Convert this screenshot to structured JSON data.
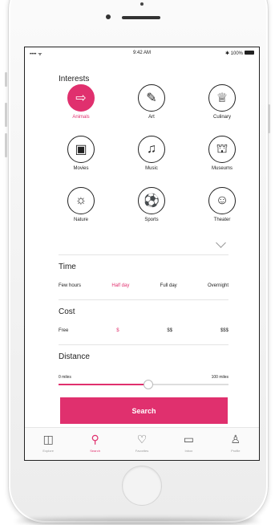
{
  "status_bar": {
    "carrier": "•••• ᯤ",
    "time": "9:42 AM",
    "battery": "✱ 100%"
  },
  "interests": {
    "title": "Interests",
    "items": [
      {
        "label": "Animals",
        "glyph": "⇨",
        "icon": "animal-paw-icon",
        "selected": true
      },
      {
        "label": "Art",
        "glyph": "✎",
        "icon": "palette-icon",
        "selected": false
      },
      {
        "label": "Culinary",
        "glyph": "♕",
        "icon": "chef-hat-icon",
        "selected": false
      },
      {
        "label": "Movies",
        "glyph": "▣",
        "icon": "film-icon",
        "selected": false
      },
      {
        "label": "Music",
        "glyph": "♫",
        "icon": "music-note-icon",
        "selected": false
      },
      {
        "label": "Museums",
        "glyph": "⛫",
        "icon": "museum-icon",
        "selected": false
      },
      {
        "label": "Nature",
        "glyph": "☼",
        "icon": "sun-icon",
        "selected": false
      },
      {
        "label": "Sports",
        "glyph": "⚽",
        "icon": "ball-icon",
        "selected": false
      },
      {
        "label": "Theater",
        "glyph": "☺",
        "icon": "theater-mask-icon",
        "selected": false
      }
    ]
  },
  "time": {
    "title": "Time",
    "options": [
      "Few hours",
      "Half day",
      "Full day",
      "Overnight"
    ],
    "selected": "Half day"
  },
  "cost": {
    "title": "Cost",
    "options": [
      "Free",
      "$",
      "$$",
      "$$$"
    ],
    "selected": "$"
  },
  "distance": {
    "title": "Distance",
    "min_label": "0 miles",
    "max_label": "100 miles",
    "value_fraction": 0.53
  },
  "search_button": {
    "label": "Search"
  },
  "tabs": [
    {
      "label": "Explore",
      "glyph": "◫",
      "icon": "map-icon",
      "active": false
    },
    {
      "label": "Search",
      "glyph": "⚲",
      "icon": "search-icon",
      "active": true
    },
    {
      "label": "Favorites",
      "glyph": "♡",
      "icon": "heart-icon",
      "active": false
    },
    {
      "label": "Inbox",
      "glyph": "▭",
      "icon": "chat-icon",
      "active": false
    },
    {
      "label": "Profile",
      "glyph": "♙",
      "icon": "profile-icon",
      "active": false
    }
  ],
  "colors": {
    "accent": "#e0306e"
  }
}
